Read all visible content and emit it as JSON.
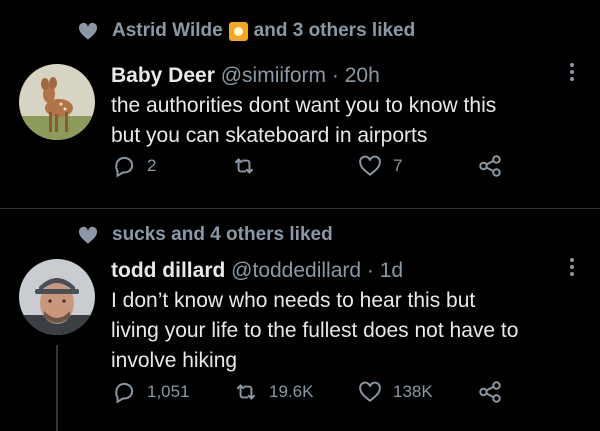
{
  "tweets": [
    {
      "social": {
        "user": "Astrid Wilde",
        "rest": "and 3 others liked",
        "has_emoji": true
      },
      "author": {
        "name": "Baby Deer",
        "handle": "@simiiform",
        "time": "· 20h"
      },
      "text": [
        "the authorities dont want you to know this",
        "but you can skateboard in airports"
      ],
      "actions": {
        "reply": "2",
        "retweet": "",
        "like": "7"
      }
    },
    {
      "social": {
        "user": "",
        "rest": "sucks and 4 others liked",
        "has_emoji": false
      },
      "author": {
        "name": "todd dillard",
        "handle": "@toddedillard",
        "time": "· 1d"
      },
      "text": [
        "I don’t know who needs to hear this but",
        "living your life to the fullest does not have to",
        "involve hiking"
      ],
      "actions": {
        "reply": "1,051",
        "retweet": "19.6K",
        "like": "138K"
      }
    }
  ],
  "colors": {
    "background": "#000000",
    "text": "#e7e9ea",
    "muted": "#8b98a5",
    "divider": "#2f3336"
  },
  "icons": [
    "heart-icon",
    "reply-icon",
    "retweet-icon",
    "like-icon",
    "share-icon",
    "more-icon"
  ]
}
